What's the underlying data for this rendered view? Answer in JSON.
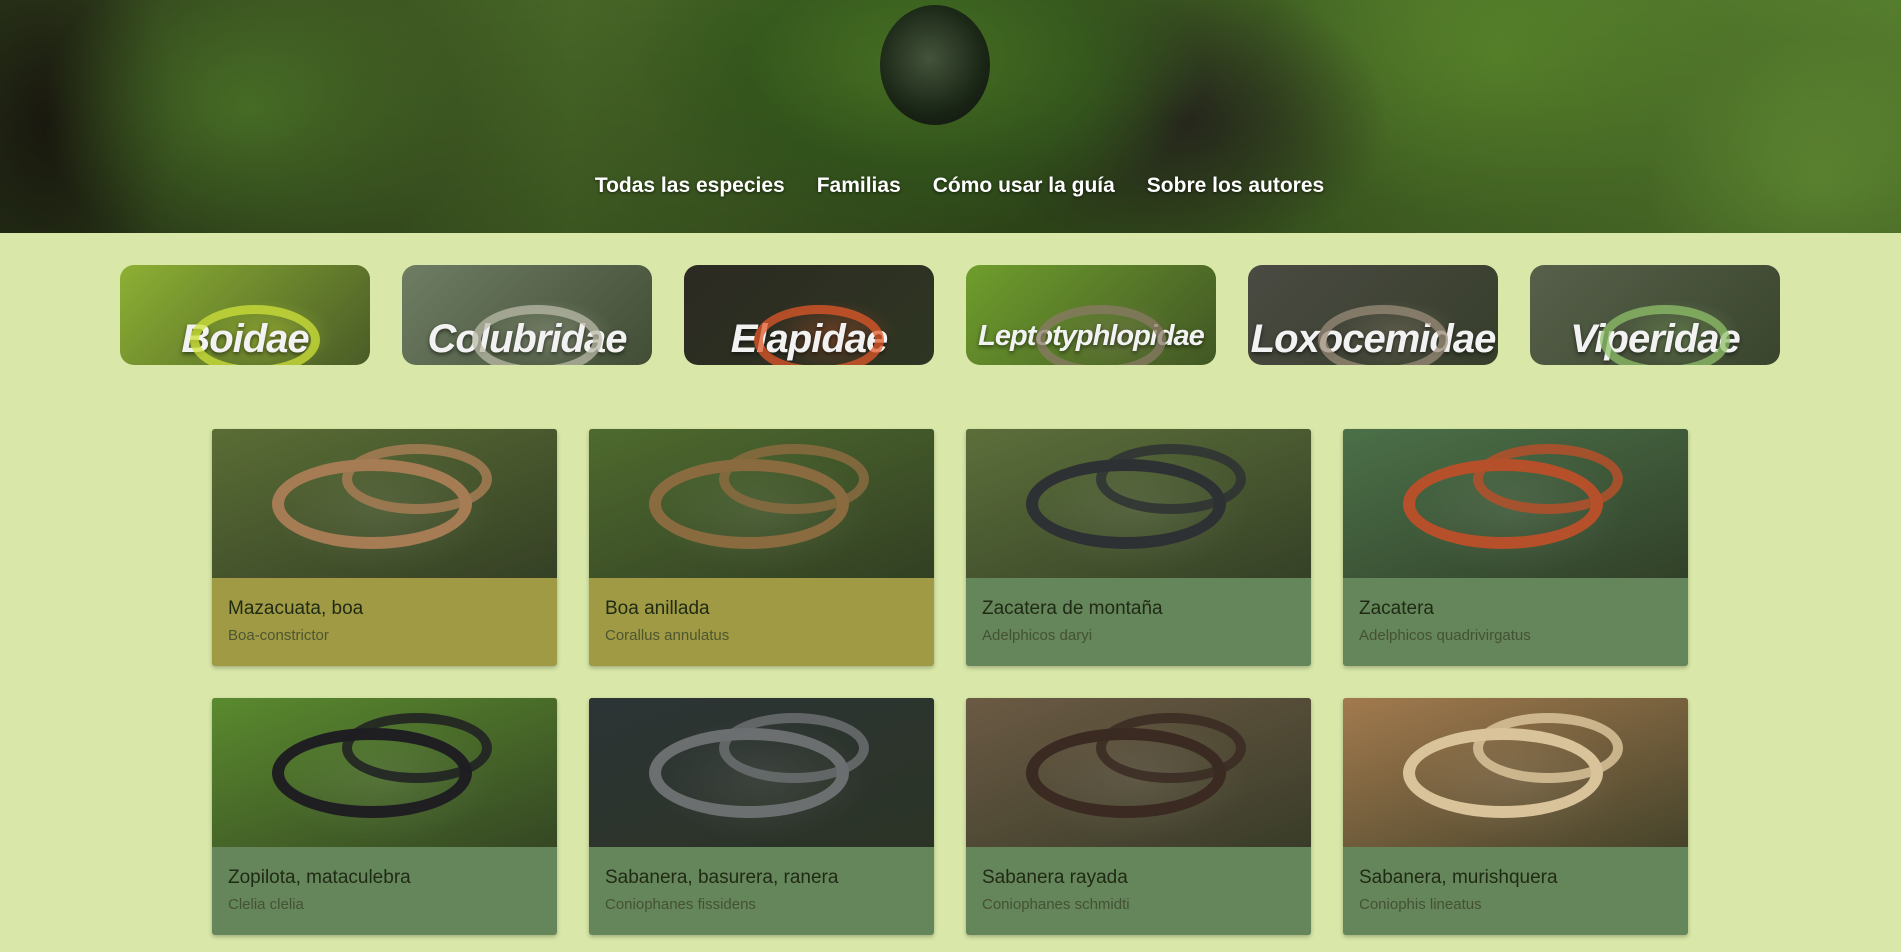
{
  "nav": {
    "items": [
      "Todas las especies",
      "Familias",
      "Cómo usar la guía",
      "Sobre los autores"
    ]
  },
  "families": [
    {
      "label": "Boidae",
      "bg": "#8db033",
      "snake": "#cfe23a"
    },
    {
      "label": "Colubridae",
      "bg": "#6f7d64",
      "snake": "#b9b9a8"
    },
    {
      "label": "Elapidae",
      "bg": "#2c2a22",
      "snake": "#e0582a"
    },
    {
      "label": "Leptotyphlopidae",
      "bg": "#6f9e2c",
      "snake": "#8a7a66"
    },
    {
      "label": "Loxocemidae",
      "bg": "#4a4a42",
      "snake": "#9a8b78"
    },
    {
      "label": "Viperidae",
      "bg": "#56604a",
      "snake": "#8fc06a"
    }
  ],
  "species": [
    {
      "common": "Mazacuata, boa",
      "scientific": "Boa-constrictor",
      "card_color": "#9f9a43",
      "img_bg": "#5a6d35",
      "snake": "#a67c55"
    },
    {
      "common": "Boa anillada",
      "scientific": "Corallus annulatus",
      "card_color": "#9f9a43",
      "img_bg": "#4e6a2e",
      "snake": "#8a6b40"
    },
    {
      "common": "Zacatera de montaña",
      "scientific": "Adelphicos daryi",
      "card_color": "#65855a",
      "img_bg": "#5c6f3a",
      "snake": "#2e3134"
    },
    {
      "common": "Zacatera",
      "scientific": "Adelphicos quadrivirgatus",
      "card_color": "#65855a",
      "img_bg": "#4b7048",
      "snake": "#b5502a"
    },
    {
      "common": "Zopilota, mataculebra",
      "scientific": "Clelia clelia",
      "card_color": "#65855a",
      "img_bg": "#5a8a2e",
      "snake": "#1f1f22"
    },
    {
      "common": "Sabanera, basurera, ranera",
      "scientific": "Coniophanes fissidens",
      "card_color": "#65855a",
      "img_bg": "#2d3436",
      "snake": "#6b6f70"
    },
    {
      "common": "Sabanera rayada",
      "scientific": "Coniophanes schmidti",
      "card_color": "#65855a",
      "img_bg": "#6b5a44",
      "snake": "#3a2a22"
    },
    {
      "common": "Sabanera, murishquera",
      "scientific": "Coniophis lineatus",
      "card_color": "#65855a",
      "img_bg": "#a27a4e",
      "snake": "#d9c39a"
    }
  ]
}
